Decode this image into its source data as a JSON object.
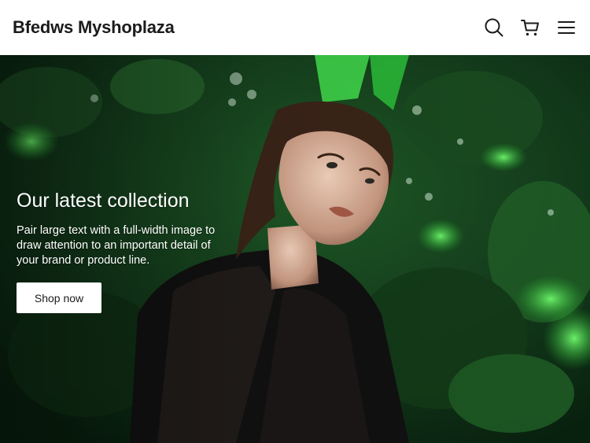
{
  "header": {
    "brand": "Bfedws Myshoplaza",
    "icons": [
      "search-icon",
      "cart-icon",
      "menu-icon"
    ]
  },
  "hero": {
    "title": "Our latest collection",
    "description": "Pair large text with a full-width image to draw attention to an important detail of your brand or product line.",
    "cta_label": "Shop now"
  },
  "colors": {
    "header_bg": "#ffffff",
    "brand_text": "#1b1b1b",
    "foliage_dark": "#0d2a12",
    "foliage_bright": "#2fae3a",
    "button_bg": "#ffffff"
  }
}
